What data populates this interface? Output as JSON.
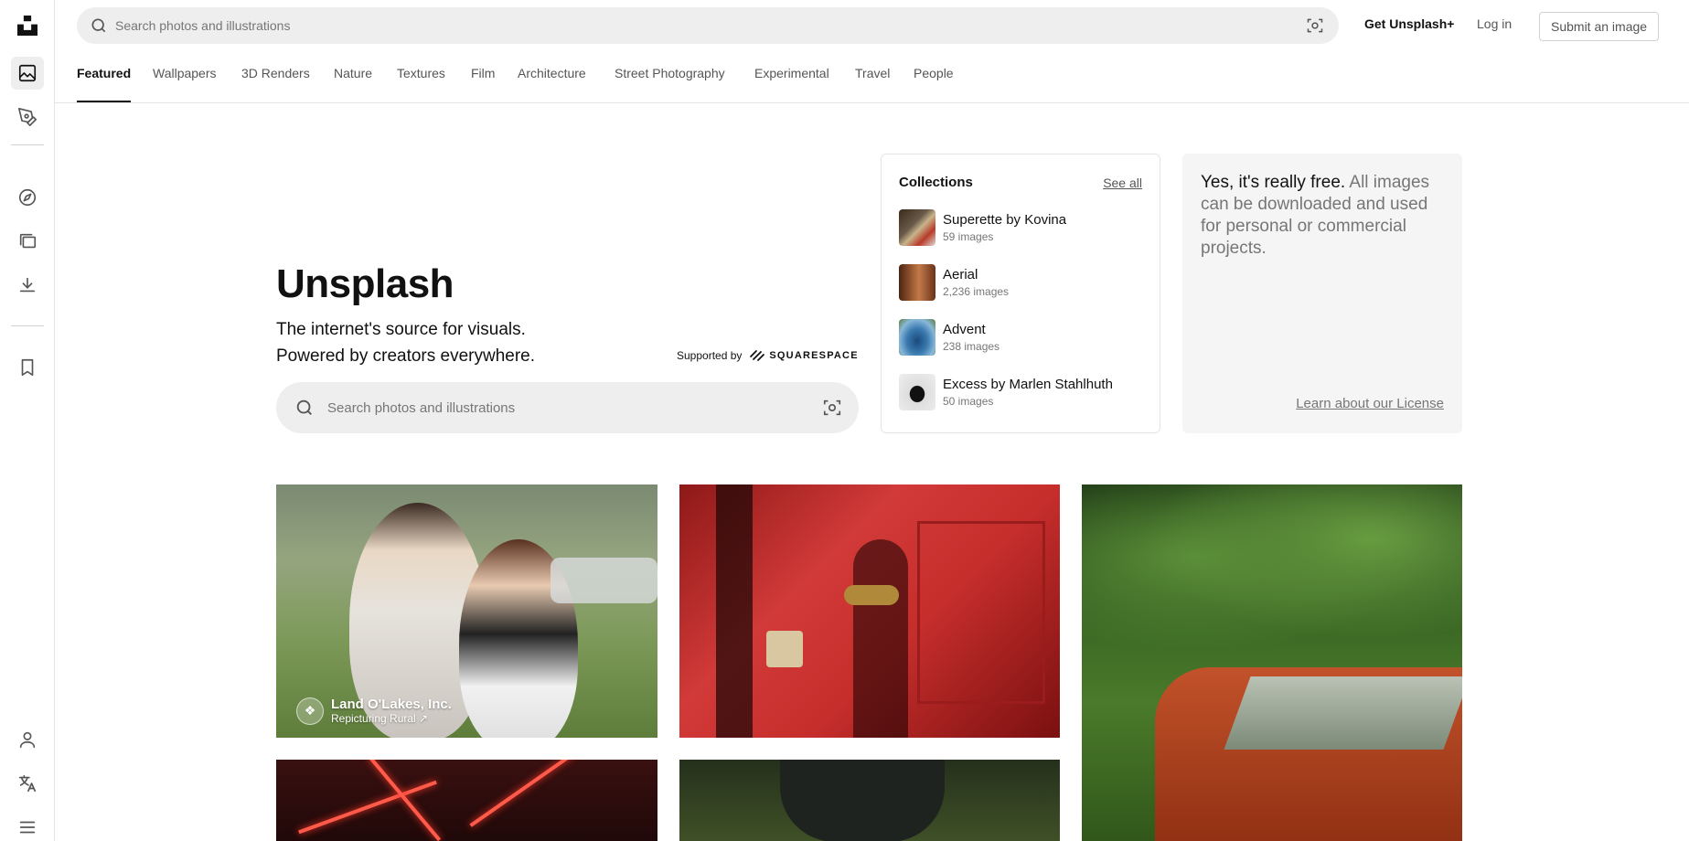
{
  "header": {
    "search_placeholder": "Search photos and illustrations",
    "get_plus": "Get Unsplash+",
    "login": "Log in",
    "submit": "Submit an image"
  },
  "tabs": [
    {
      "label": "Featured",
      "active": true
    },
    {
      "label": "Wallpapers"
    },
    {
      "label": "3D Renders"
    },
    {
      "label": "Nature"
    },
    {
      "label": "Textures"
    },
    {
      "label": "Film"
    },
    {
      "label": "Architecture"
    },
    {
      "label": "Street Photography"
    },
    {
      "label": "Experimental"
    },
    {
      "label": "Travel"
    },
    {
      "label": "People"
    }
  ],
  "sidebar": {
    "icons": [
      "unsplash-logo-icon",
      "photos-icon",
      "illustrations-icon",
      "explore-icon",
      "collections-icon",
      "downloads-icon",
      "bookmark-icon",
      "account-icon",
      "language-icon",
      "menu-icon"
    ]
  },
  "hero": {
    "title": "Unsplash",
    "subtitle_line1": "The internet's source for visuals.",
    "subtitle_line2": "Powered by creators everywhere.",
    "supported_by": "Supported by",
    "sponsor": "SQUARESPACE",
    "search_placeholder": "Search photos and illustrations"
  },
  "collections": {
    "heading": "Collections",
    "see_all": "See all",
    "items": [
      {
        "name": "Superette by Kovina",
        "count": "59 images",
        "color": "#8a6a4a"
      },
      {
        "name": "Aerial",
        "count": "2,236 images",
        "color": "#9a5a32"
      },
      {
        "name": "Advent",
        "count": "238 images",
        "color": "#3a7ab0"
      },
      {
        "name": "Excess by Marlen Stahlhuth",
        "count": "50 images",
        "color": "#d8d8d8"
      }
    ]
  },
  "free": {
    "strong": "Yes, it's really free.",
    "muted": "All images can be downloaded and used for personal or commercial projects.",
    "license_link": "Learn about our License"
  },
  "photos": [
    {
      "sponsor_name": "Land O'Lakes, Inc.",
      "sponsor_tag": "Repicturing Rural ↗"
    }
  ]
}
